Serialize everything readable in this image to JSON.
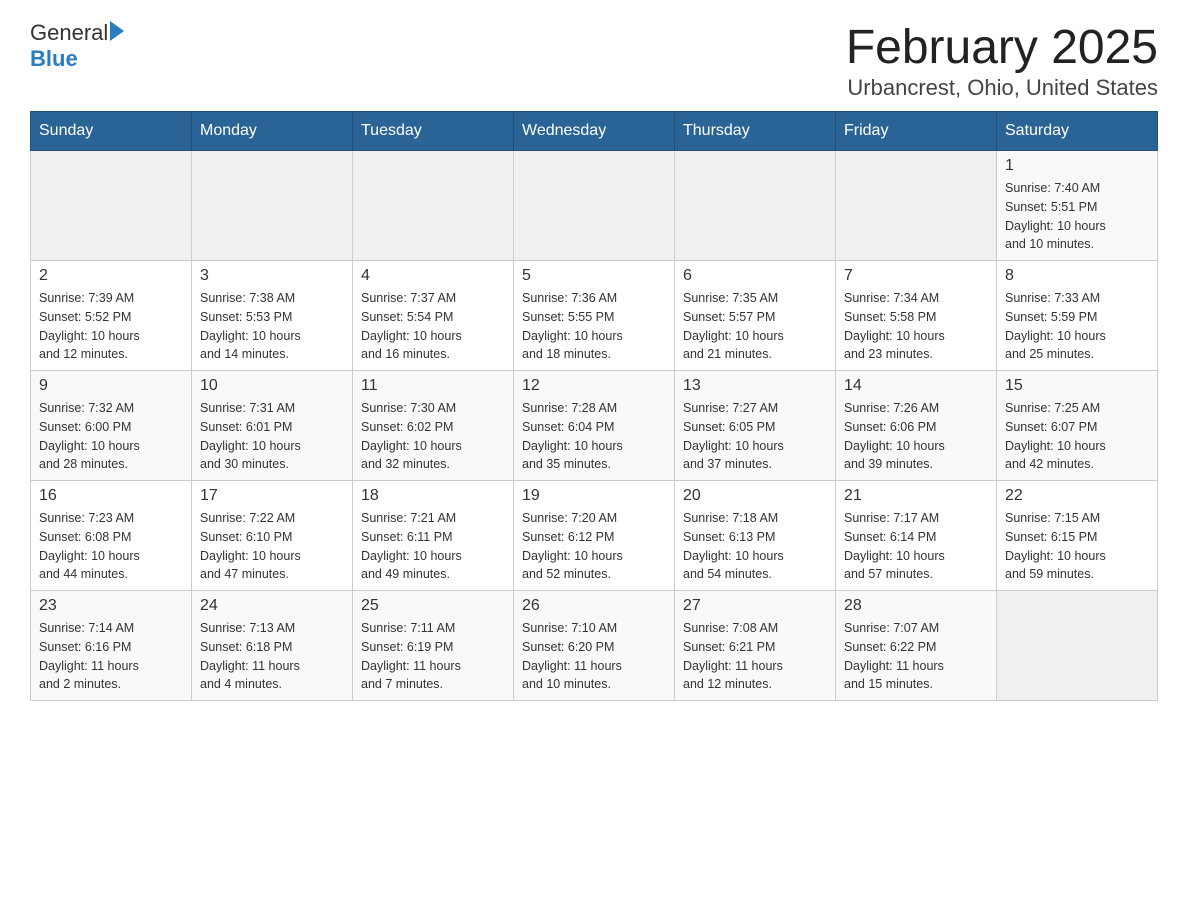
{
  "logo": {
    "text_general": "General",
    "text_blue": "Blue",
    "arrow_char": "▶"
  },
  "title": "February 2025",
  "subtitle": "Urbancrest, Ohio, United States",
  "weekdays": [
    "Sunday",
    "Monday",
    "Tuesday",
    "Wednesday",
    "Thursday",
    "Friday",
    "Saturday"
  ],
  "weeks": [
    [
      {
        "day": "",
        "info": ""
      },
      {
        "day": "",
        "info": ""
      },
      {
        "day": "",
        "info": ""
      },
      {
        "day": "",
        "info": ""
      },
      {
        "day": "",
        "info": ""
      },
      {
        "day": "",
        "info": ""
      },
      {
        "day": "1",
        "info": "Sunrise: 7:40 AM\nSunset: 5:51 PM\nDaylight: 10 hours\nand 10 minutes."
      }
    ],
    [
      {
        "day": "2",
        "info": "Sunrise: 7:39 AM\nSunset: 5:52 PM\nDaylight: 10 hours\nand 12 minutes."
      },
      {
        "day": "3",
        "info": "Sunrise: 7:38 AM\nSunset: 5:53 PM\nDaylight: 10 hours\nand 14 minutes."
      },
      {
        "day": "4",
        "info": "Sunrise: 7:37 AM\nSunset: 5:54 PM\nDaylight: 10 hours\nand 16 minutes."
      },
      {
        "day": "5",
        "info": "Sunrise: 7:36 AM\nSunset: 5:55 PM\nDaylight: 10 hours\nand 18 minutes."
      },
      {
        "day": "6",
        "info": "Sunrise: 7:35 AM\nSunset: 5:57 PM\nDaylight: 10 hours\nand 21 minutes."
      },
      {
        "day": "7",
        "info": "Sunrise: 7:34 AM\nSunset: 5:58 PM\nDaylight: 10 hours\nand 23 minutes."
      },
      {
        "day": "8",
        "info": "Sunrise: 7:33 AM\nSunset: 5:59 PM\nDaylight: 10 hours\nand 25 minutes."
      }
    ],
    [
      {
        "day": "9",
        "info": "Sunrise: 7:32 AM\nSunset: 6:00 PM\nDaylight: 10 hours\nand 28 minutes."
      },
      {
        "day": "10",
        "info": "Sunrise: 7:31 AM\nSunset: 6:01 PM\nDaylight: 10 hours\nand 30 minutes."
      },
      {
        "day": "11",
        "info": "Sunrise: 7:30 AM\nSunset: 6:02 PM\nDaylight: 10 hours\nand 32 minutes."
      },
      {
        "day": "12",
        "info": "Sunrise: 7:28 AM\nSunset: 6:04 PM\nDaylight: 10 hours\nand 35 minutes."
      },
      {
        "day": "13",
        "info": "Sunrise: 7:27 AM\nSunset: 6:05 PM\nDaylight: 10 hours\nand 37 minutes."
      },
      {
        "day": "14",
        "info": "Sunrise: 7:26 AM\nSunset: 6:06 PM\nDaylight: 10 hours\nand 39 minutes."
      },
      {
        "day": "15",
        "info": "Sunrise: 7:25 AM\nSunset: 6:07 PM\nDaylight: 10 hours\nand 42 minutes."
      }
    ],
    [
      {
        "day": "16",
        "info": "Sunrise: 7:23 AM\nSunset: 6:08 PM\nDaylight: 10 hours\nand 44 minutes."
      },
      {
        "day": "17",
        "info": "Sunrise: 7:22 AM\nSunset: 6:10 PM\nDaylight: 10 hours\nand 47 minutes."
      },
      {
        "day": "18",
        "info": "Sunrise: 7:21 AM\nSunset: 6:11 PM\nDaylight: 10 hours\nand 49 minutes."
      },
      {
        "day": "19",
        "info": "Sunrise: 7:20 AM\nSunset: 6:12 PM\nDaylight: 10 hours\nand 52 minutes."
      },
      {
        "day": "20",
        "info": "Sunrise: 7:18 AM\nSunset: 6:13 PM\nDaylight: 10 hours\nand 54 minutes."
      },
      {
        "day": "21",
        "info": "Sunrise: 7:17 AM\nSunset: 6:14 PM\nDaylight: 10 hours\nand 57 minutes."
      },
      {
        "day": "22",
        "info": "Sunrise: 7:15 AM\nSunset: 6:15 PM\nDaylight: 10 hours\nand 59 minutes."
      }
    ],
    [
      {
        "day": "23",
        "info": "Sunrise: 7:14 AM\nSunset: 6:16 PM\nDaylight: 11 hours\nand 2 minutes."
      },
      {
        "day": "24",
        "info": "Sunrise: 7:13 AM\nSunset: 6:18 PM\nDaylight: 11 hours\nand 4 minutes."
      },
      {
        "day": "25",
        "info": "Sunrise: 7:11 AM\nSunset: 6:19 PM\nDaylight: 11 hours\nand 7 minutes."
      },
      {
        "day": "26",
        "info": "Sunrise: 7:10 AM\nSunset: 6:20 PM\nDaylight: 11 hours\nand 10 minutes."
      },
      {
        "day": "27",
        "info": "Sunrise: 7:08 AM\nSunset: 6:21 PM\nDaylight: 11 hours\nand 12 minutes."
      },
      {
        "day": "28",
        "info": "Sunrise: 7:07 AM\nSunset: 6:22 PM\nDaylight: 11 hours\nand 15 minutes."
      },
      {
        "day": "",
        "info": ""
      }
    ]
  ]
}
